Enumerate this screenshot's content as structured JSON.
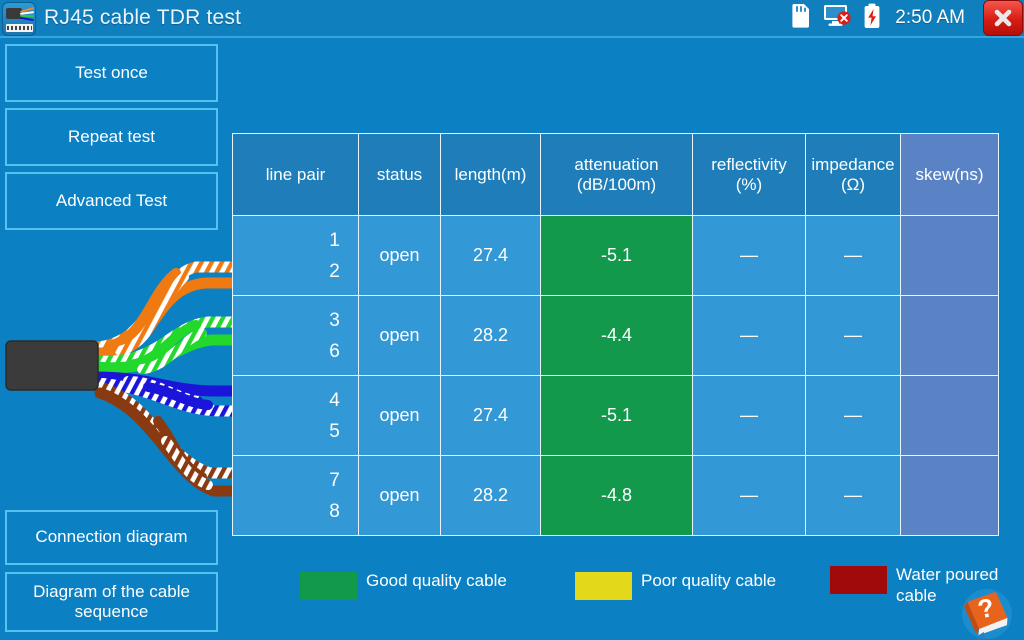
{
  "titlebar": {
    "app_icon_name": "rj45-cable-icon",
    "title": "RJ45 cable TDR test",
    "status_icons": [
      {
        "name": "sd-card-icon",
        "label": "SD card"
      },
      {
        "name": "monitor-disconnected-icon",
        "label": "Monitor disconnected"
      },
      {
        "name": "battery-charging-icon",
        "label": "Battery charging"
      }
    ],
    "clock": "2:50 AM",
    "close_label": "×"
  },
  "buttons": {
    "test_once": "Test once",
    "repeat_test": "Repeat test",
    "advanced_test": "Advanced Test",
    "connection_diagram": "Connection diagram",
    "cable_sequence": "Diagram of the cable sequence"
  },
  "table": {
    "headers": [
      {
        "line1": "line pair",
        "line2": ""
      },
      {
        "line1": "status",
        "line2": ""
      },
      {
        "line1": "length(m)",
        "line2": ""
      },
      {
        "line1": "attenuation",
        "line2": "(dB/100m)"
      },
      {
        "line1": "reflectivity",
        "line2": "(%)"
      },
      {
        "line1": "impedance",
        "line2": "(Ω)"
      },
      {
        "line1": "skew(ns)",
        "line2": ""
      }
    ],
    "rows": [
      {
        "pair_top": "1",
        "pair_bottom": "2",
        "wire_striped_color": "#f07a12",
        "wire_solid_color": "#f07a12",
        "striped_on_top": true,
        "status": "open",
        "length": "27.4",
        "attenuation": "-5.1",
        "reflectivity": "—",
        "impedance": "—",
        "skew": ""
      },
      {
        "pair_top": "3",
        "pair_bottom": "6",
        "wire_striped_color": "#22d82a",
        "wire_solid_color": "#22d82a",
        "striped_on_top": true,
        "status": "open",
        "length": "28.2",
        "attenuation": "-4.4",
        "reflectivity": "—",
        "impedance": "—",
        "skew": ""
      },
      {
        "pair_top": "4",
        "pair_bottom": "5",
        "wire_striped_color": "#1a15d8",
        "wire_solid_color": "#1a15d8",
        "striped_on_top": false,
        "status": "open",
        "length": "27.4",
        "attenuation": "-5.1",
        "reflectivity": "—",
        "impedance": "—",
        "skew": ""
      },
      {
        "pair_top": "7",
        "pair_bottom": "8",
        "wire_striped_color": "#8a3a10",
        "wire_solid_color": "#8a3a10",
        "striped_on_top": true,
        "status": "open",
        "length": "28.2",
        "attenuation": "-4.8",
        "reflectivity": "—",
        "impedance": "—",
        "skew": ""
      }
    ]
  },
  "legend": [
    {
      "name": "good-quality",
      "color": "#13994b",
      "label": "Good quality cable"
    },
    {
      "name": "poor-quality",
      "color": "#e3d81a",
      "label": "Poor quality cable"
    },
    {
      "name": "water-poured",
      "color": "#a00a0a",
      "label": "Water poured cable"
    }
  ],
  "help": {
    "name": "help-book-icon",
    "glyph": "?"
  },
  "colors": {
    "page_bg": "#0b80c3",
    "titlebar_bg": "#0f7fbe",
    "table_header_bg": "#1f7eba",
    "table_cell_bg": "#3399d6",
    "attenuation_good_bg": "#13994b",
    "skew_bg": "#5a83c6",
    "button_border": "#55c2ef",
    "close_btn": "#d81c14"
  }
}
